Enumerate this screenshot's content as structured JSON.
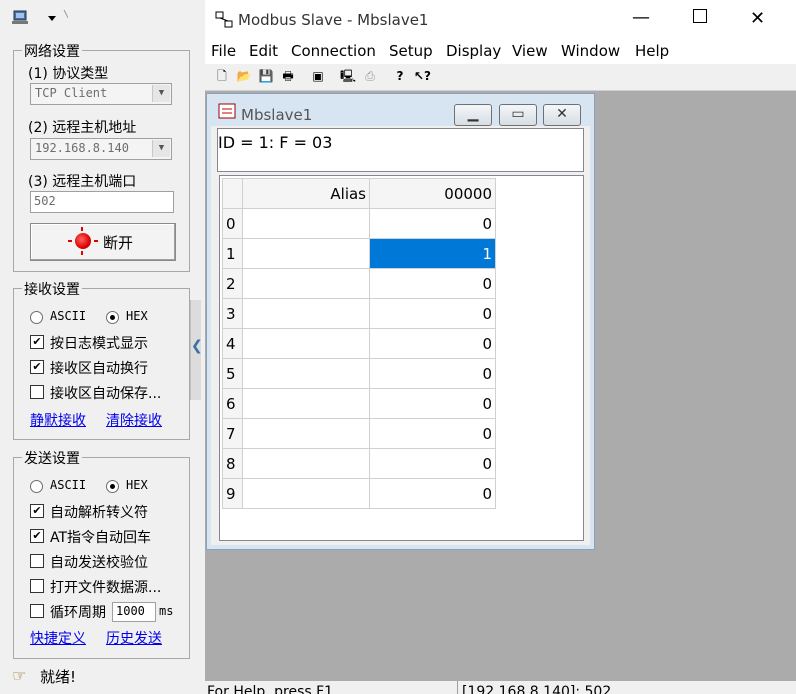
{
  "left_panel": {
    "network_group": {
      "title": "网络设置",
      "protocol_label": "(1) 协议类型",
      "protocol_value": "TCP Client",
      "host_label": "(2) 远程主机地址",
      "host_value": "192.168.8.140",
      "port_label": "(3) 远程主机端口",
      "port_value": "502",
      "connect_button": "断开"
    },
    "receive_group": {
      "title": "接收设置",
      "radio_ascii": "ASCII",
      "radio_hex": "HEX",
      "opt_log_mode": "按日志模式显示",
      "opt_auto_wrap": "接收区自动换行",
      "opt_auto_save": "接收区自动保存...",
      "link_silent": "静默接收",
      "link_clear": "清除接收"
    },
    "send_group": {
      "title": "发送设置",
      "radio_ascii": "ASCII",
      "radio_hex": "HEX",
      "opt_escape": "自动解析转义符",
      "opt_at_cr": "AT指令自动回车",
      "opt_checksum": "自动发送校验位",
      "opt_open_file": "打开文件数据源...",
      "opt_cycle": "循环周期",
      "cycle_value": "1000",
      "cycle_unit": "ms",
      "link_shortcut": "快捷定义",
      "link_history": "历史发送"
    },
    "status": "就绪!"
  },
  "window": {
    "title": "Modbus Slave - Mbslave1",
    "menu": [
      "File",
      "Edit",
      "Connection",
      "Setup",
      "Display",
      "View",
      "Window",
      "Help"
    ],
    "status_help": "For Help, press F1",
    "status_conn": "[192.168.8.140]: 502"
  },
  "child": {
    "title": "Mbslave1",
    "header": "ID = 1: F = 03",
    "col_alias": "Alias",
    "col_addr": "00000",
    "rows": [
      {
        "idx": "0",
        "alias": "",
        "value": "0"
      },
      {
        "idx": "1",
        "alias": "",
        "value": "1"
      },
      {
        "idx": "2",
        "alias": "",
        "value": "0"
      },
      {
        "idx": "3",
        "alias": "",
        "value": "0"
      },
      {
        "idx": "4",
        "alias": "",
        "value": "0"
      },
      {
        "idx": "5",
        "alias": "",
        "value": "0"
      },
      {
        "idx": "6",
        "alias": "",
        "value": "0"
      },
      {
        "idx": "7",
        "alias": "",
        "value": "0"
      },
      {
        "idx": "8",
        "alias": "",
        "value": "0"
      },
      {
        "idx": "9",
        "alias": "",
        "value": "0"
      }
    ],
    "selected_row": 1
  },
  "colors": {
    "selection": "#0078d7",
    "link": "#0000ee",
    "mdi_background": "#ababab"
  }
}
